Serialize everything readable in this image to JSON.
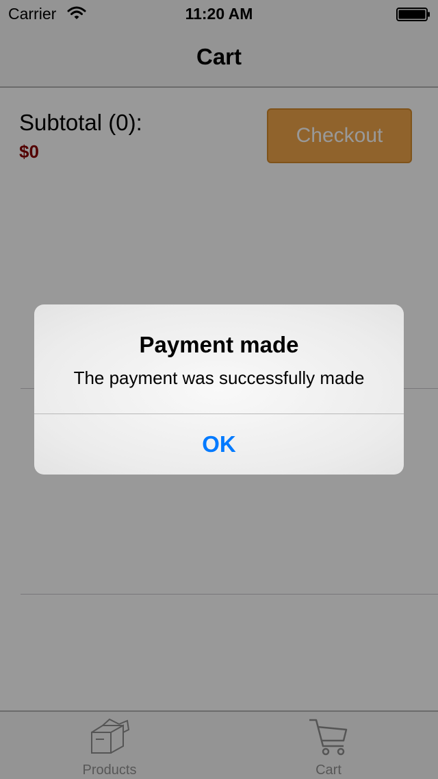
{
  "status_bar": {
    "carrier": "Carrier",
    "time": "11:20 AM",
    "wifi_icon": "wifi-icon",
    "battery_icon": "battery-icon"
  },
  "nav_bar": {
    "title": "Cart"
  },
  "cart": {
    "subtotal_label": "Subtotal (0):",
    "subtotal_value": "$0",
    "checkout_label": "Checkout",
    "checkout_color": "#f0a54a",
    "price_color": "#8b0000"
  },
  "alert": {
    "title": "Payment made",
    "message": "The payment was successfully made",
    "ok_label": "OK",
    "ok_color": "#007aff"
  },
  "tab_bar": {
    "tabs": [
      {
        "label": "Products",
        "icon": "box-icon"
      },
      {
        "label": "Cart",
        "icon": "cart-icon"
      }
    ]
  }
}
